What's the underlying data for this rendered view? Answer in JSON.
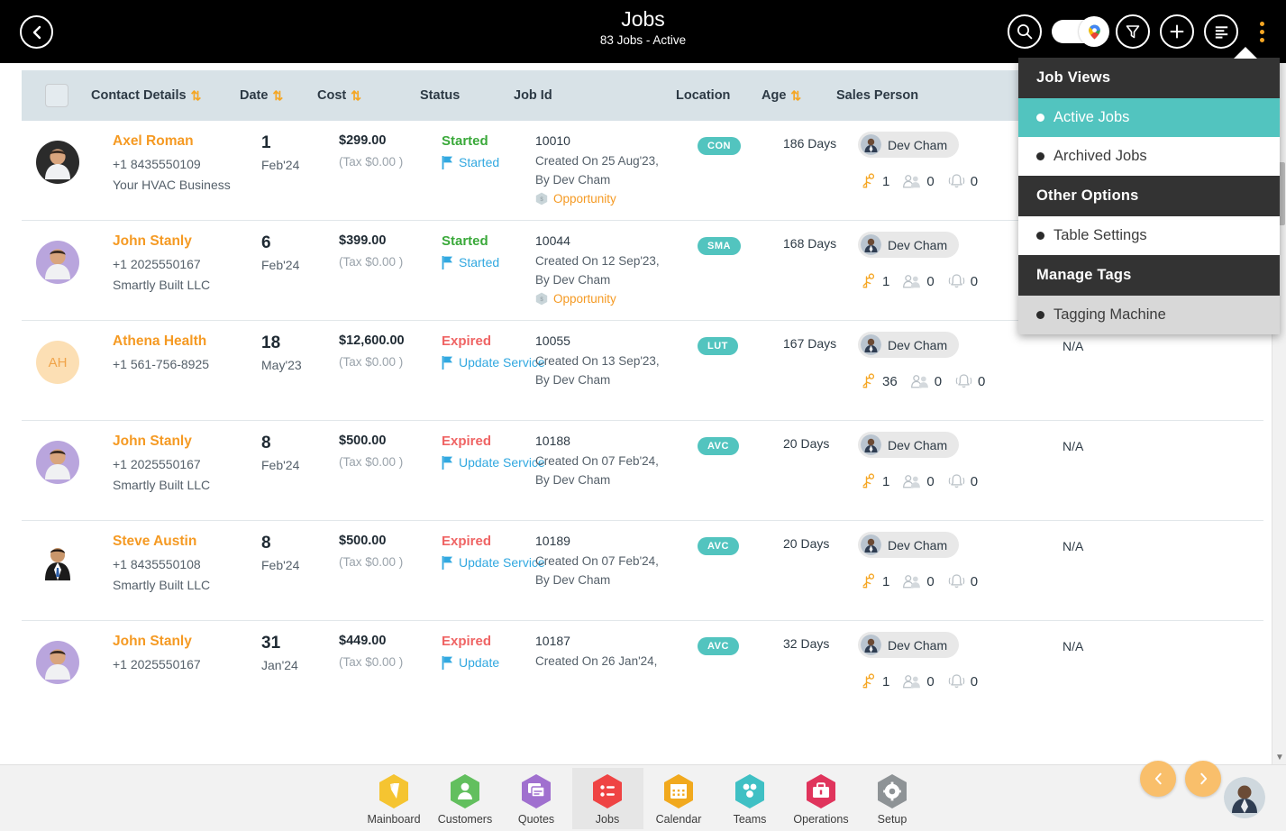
{
  "header": {
    "back_icon": "chevron-left-icon",
    "title": "Jobs",
    "subtitle": "83 Jobs - Active",
    "icons": {
      "search": "search-icon",
      "map_toggle": "map-pin-toggle",
      "filter": "filter-icon",
      "add": "plus-icon",
      "list": "list-lines-icon",
      "more": "kebab-menu-icon"
    }
  },
  "dropdown": {
    "sections": [
      {
        "heading": "Job Views",
        "items": [
          {
            "label": "Active Jobs",
            "state": "active"
          },
          {
            "label": "Archived Jobs",
            "state": "normal"
          }
        ]
      },
      {
        "heading": "Other Options",
        "items": [
          {
            "label": "Table Settings",
            "state": "normal"
          }
        ]
      },
      {
        "heading": "Manage Tags",
        "items": [
          {
            "label": "Tagging Machine",
            "state": "tint"
          }
        ]
      }
    ]
  },
  "table": {
    "columns": [
      {
        "label": "Contact Details",
        "sortable": true
      },
      {
        "label": "Date",
        "sortable": true
      },
      {
        "label": "Cost",
        "sortable": true
      },
      {
        "label": "Status",
        "sortable": false
      },
      {
        "label": "Job Id",
        "sortable": false
      },
      {
        "label": "Location",
        "sortable": false
      },
      {
        "label": "Age",
        "sortable": true
      },
      {
        "label": "Sales Person",
        "sortable": false
      }
    ],
    "rows": [
      {
        "avatar_type": "photo",
        "avatar_tone": "#2b2b2b",
        "name": "Axel Roman",
        "phone": "+1 8435550109",
        "company": "Your HVAC Business",
        "date_day": "1",
        "date_month": "Feb'24",
        "cost": "$299.00",
        "tax": "(Tax $0.00 )",
        "status": "Started",
        "status_kind": "started",
        "action": "Started",
        "job_id": "10010",
        "created": "Created On 25 Aug'23,",
        "created_by": "By Dev Cham",
        "opportunity": "Opportunity",
        "location": "CON",
        "age": "186 Days",
        "sales_person": "Dev Cham",
        "count_tasks": "1",
        "count_team": "0",
        "count_alerts": "0",
        "na": ""
      },
      {
        "avatar_type": "photo",
        "avatar_tone": "#b9a5dd",
        "name": "John Stanly",
        "phone": "+1 2025550167",
        "company": "Smartly Built LLC",
        "date_day": "6",
        "date_month": "Feb'24",
        "cost": "$399.00",
        "tax": "(Tax $0.00 )",
        "status": "Started",
        "status_kind": "started",
        "action": "Started",
        "job_id": "10044",
        "created": "Created On 12 Sep'23,",
        "created_by": "By Dev Cham",
        "opportunity": "Opportunity",
        "location": "SMA",
        "age": "168 Days",
        "sales_person": "Dev Cham",
        "count_tasks": "1",
        "count_team": "0",
        "count_alerts": "0",
        "na": ""
      },
      {
        "avatar_type": "initials",
        "avatar_initials": "AH",
        "avatar_tone": "#fcdfb4",
        "name": "Athena Health",
        "phone": "+1 561-756-8925",
        "company": "",
        "date_day": "18",
        "date_month": "May'23",
        "cost": "$12,600.00",
        "tax": "(Tax $0.00 )",
        "status": "Expired",
        "status_kind": "expired",
        "action": "Update Service",
        "job_id": "10055",
        "created": "Created On 13 Sep'23,",
        "created_by": "By Dev Cham",
        "opportunity": "",
        "location": "LUT",
        "age": "167 Days",
        "sales_person": "Dev Cham",
        "count_tasks": "36",
        "count_team": "0",
        "count_alerts": "0",
        "na": "N/A"
      },
      {
        "avatar_type": "photo",
        "avatar_tone": "#b9a5dd",
        "name": "John Stanly",
        "phone": "+1 2025550167",
        "company": "Smartly Built LLC",
        "date_day": "8",
        "date_month": "Feb'24",
        "cost": "$500.00",
        "tax": "(Tax $0.00 )",
        "status": "Expired",
        "status_kind": "expired",
        "action": "Update Service",
        "job_id": "10188",
        "created": "Created On 07 Feb'24,",
        "created_by": "By Dev Cham",
        "opportunity": "",
        "location": "AVC",
        "age": "20 Days",
        "sales_person": "Dev Cham",
        "count_tasks": "1",
        "count_team": "0",
        "count_alerts": "0",
        "na": "N/A"
      },
      {
        "avatar_type": "photo",
        "avatar_tone": "#ffffff",
        "name": "Steve Austin",
        "phone": "+1 8435550108",
        "company": "Smartly Built LLC",
        "date_day": "8",
        "date_month": "Feb'24",
        "cost": "$500.00",
        "tax": "(Tax $0.00 )",
        "status": "Expired",
        "status_kind": "expired",
        "action": "Update Service",
        "job_id": "10189",
        "created": "Created On 07 Feb'24,",
        "created_by": "By Dev Cham",
        "opportunity": "",
        "location": "AVC",
        "age": "20 Days",
        "sales_person": "Dev Cham",
        "count_tasks": "1",
        "count_team": "0",
        "count_alerts": "0",
        "na": "N/A"
      },
      {
        "avatar_type": "photo",
        "avatar_tone": "#b9a5dd",
        "name": "John Stanly",
        "phone": "+1 2025550167",
        "company": "",
        "date_day": "31",
        "date_month": "Jan'24",
        "cost": "$449.00",
        "tax": "(Tax $0.00 )",
        "status": "Expired",
        "status_kind": "expired",
        "action": "Update",
        "job_id": "10187",
        "created": "Created On 26 Jan'24,",
        "created_by": "",
        "opportunity": "",
        "location": "AVC",
        "age": "32 Days",
        "sales_person": "Dev Cham",
        "count_tasks": "1",
        "count_team": "0",
        "count_alerts": "0",
        "na": "N/A"
      }
    ]
  },
  "pagination": {
    "prev_icon": "chevron-left-icon",
    "next_icon": "chevron-right-icon"
  },
  "bottom_nav": {
    "items": [
      {
        "label": "Mainboard",
        "color": "#f5c431",
        "icon": "mainboard-icon",
        "selected": false
      },
      {
        "label": "Customers",
        "color": "#62bf5e",
        "icon": "customers-icon",
        "selected": false
      },
      {
        "label": "Quotes",
        "color": "#a070cf",
        "icon": "quotes-icon",
        "selected": false
      },
      {
        "label": "Jobs",
        "color": "#ef4444",
        "icon": "jobs-icon",
        "selected": true
      },
      {
        "label": "Calendar",
        "color": "#f1a91e",
        "icon": "calendar-icon",
        "selected": false
      },
      {
        "label": "Teams",
        "color": "#3fc0c4",
        "icon": "teams-icon",
        "selected": false
      },
      {
        "label": "Operations",
        "color": "#e0345c",
        "icon": "operations-icon",
        "selected": false
      },
      {
        "label": "Setup",
        "color": "#8e9396",
        "icon": "gear-icon",
        "selected": false
      }
    ]
  },
  "colors": {
    "accent_teal": "#52c4bf",
    "accent_orange": "#f59a23",
    "status_started": "#3aa93a",
    "status_expired": "#ef6464",
    "link_blue": "#31a8e0",
    "header_bg": "#000000",
    "table_header_bg": "#d8e2e7"
  }
}
